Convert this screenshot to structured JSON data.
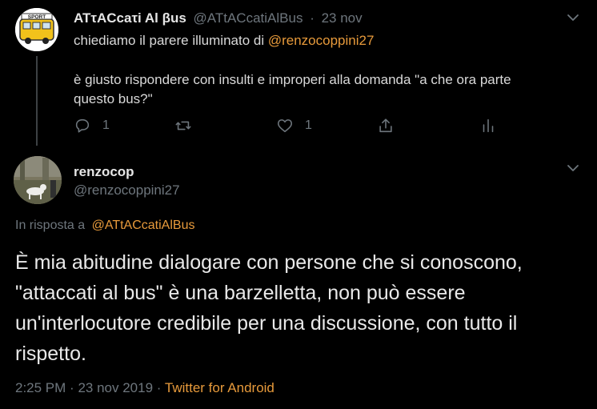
{
  "parent_tweet": {
    "display_name": "ATτACcaτi Al βus",
    "handle": "@ATtACcatiAlBus",
    "date": "23 nov",
    "text_line1_prefix": "chiediamo il parere illuminato di ",
    "text_line1_mention": "@renzocoppini27",
    "text_line3": "è giusto rispondere con insulti e improperi alla domanda \"a che ora parte",
    "text_line4": "questo bus?\"",
    "reply_count": "1",
    "retweet_count": "",
    "like_count": "1",
    "avatar_text": "SPORT"
  },
  "main_tweet": {
    "display_name": "renzocop",
    "handle": "@renzocoppini27",
    "reply_prefix": "In risposta a",
    "reply_mention": "@ATtACcatiAlBus",
    "body": "È mia abitudine dialogare con persone che si conoscono, \"attaccati al bus\" è una barzelletta, non può essere un'interlocutore credibile per una discussione, con tutto il rispetto.",
    "time": "2:25 PM",
    "date": "23 nov 2019",
    "separator": "·",
    "source": "Twitter for Android"
  },
  "colors": {
    "background": "#000000",
    "accent": "#e79a3b",
    "muted": "#6e767d",
    "text": "#d9d9d9"
  },
  "icons": {
    "caret": "chevron-down-icon",
    "reply": "reply-icon",
    "retweet": "retweet-icon",
    "like": "heart-icon",
    "share": "share-icon",
    "analytics": "analytics-icon"
  }
}
